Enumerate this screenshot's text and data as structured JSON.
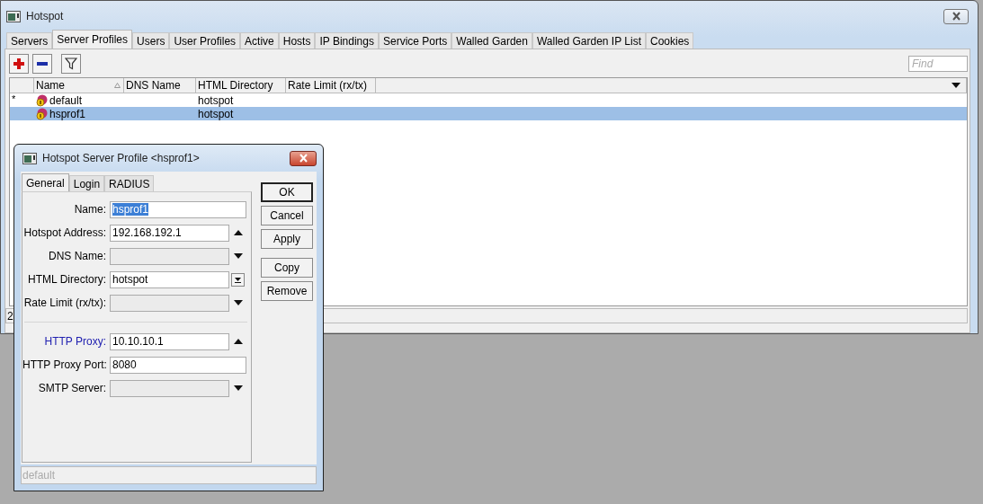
{
  "window": {
    "title": "Hotspot"
  },
  "tabs": [
    {
      "label": "Servers",
      "selected": false
    },
    {
      "label": "Server Profiles",
      "selected": true
    },
    {
      "label": "Users",
      "selected": false
    },
    {
      "label": "User Profiles",
      "selected": false
    },
    {
      "label": "Active",
      "selected": false
    },
    {
      "label": "Hosts",
      "selected": false
    },
    {
      "label": "IP Bindings",
      "selected": false
    },
    {
      "label": "Service Ports",
      "selected": false
    },
    {
      "label": "Walled Garden",
      "selected": false
    },
    {
      "label": "Walled Garden IP List",
      "selected": false
    },
    {
      "label": "Cookies",
      "selected": false
    }
  ],
  "toolbar": {
    "find": {
      "placeholder": "Find"
    }
  },
  "table": {
    "columns": [
      {
        "label": "Name",
        "sorted": true
      },
      {
        "label": "DNS Name",
        "sorted": false
      },
      {
        "label": "HTML Directory",
        "sorted": false
      },
      {
        "label": "Rate Limit (rx/tx)",
        "sorted": false
      }
    ],
    "rows": [
      {
        "marker": "*",
        "name": "default",
        "html_directory": "hotspot",
        "selected": false
      },
      {
        "name": "hsprof1",
        "html_directory": "hotspot",
        "selected": true
      }
    ]
  },
  "status_bar": {
    "count": "2"
  },
  "dialog": {
    "title": "Hotspot Server Profile <hsprof1>",
    "tabs": [
      {
        "label": "General",
        "selected": true
      },
      {
        "label": "Login",
        "selected": false
      },
      {
        "label": "RADIUS",
        "selected": false
      }
    ],
    "fields": [
      {
        "kind": "plain",
        "label": "Name:",
        "value": "hsprof1",
        "value_selected": true,
        "disabled": false,
        "emphasized": false
      },
      {
        "kind": "up",
        "label": "Hotspot Address:",
        "value": "192.168.192.1",
        "disabled": false,
        "emphasized": false
      },
      {
        "kind": "down",
        "label": "DNS Name:",
        "disabled": true,
        "emphasized": false
      },
      {
        "kind": "list",
        "label": "HTML Directory:",
        "value": "hotspot",
        "disabled": false,
        "emphasized": false
      },
      {
        "kind": "down",
        "label": "Rate Limit (rx/tx):",
        "disabled": true,
        "emphasized": false
      },
      {
        "kind": "separator"
      },
      {
        "kind": "up",
        "label": "HTTP Proxy:",
        "value": "10.10.10.1",
        "disabled": false,
        "emphasized": true
      },
      {
        "kind": "plain",
        "label": "HTTP Proxy Port:",
        "value": "8080",
        "disabled": false,
        "emphasized": false
      },
      {
        "kind": "down",
        "label": "SMTP Server:",
        "disabled": true,
        "emphasized": false
      }
    ],
    "button_groups": [
      [
        {
          "label": "OK",
          "default": true
        },
        {
          "label": "Cancel",
          "default": false
        },
        {
          "label": "Apply",
          "default": false
        }
      ],
      [
        {
          "label": "Copy",
          "default": false
        },
        {
          "label": "Remove",
          "default": false
        }
      ]
    ],
    "status": "default"
  }
}
